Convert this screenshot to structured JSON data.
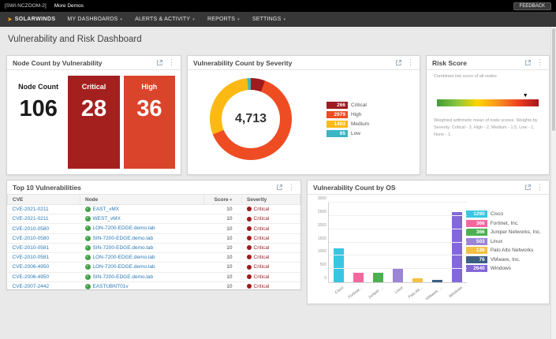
{
  "topbar": {
    "site_label": "[SWI-NCZOOM-2]",
    "more_demos_label": "More Demos",
    "feedback_label": "FEEDBACK"
  },
  "nav": {
    "brand": "SOLARWINDS",
    "items": [
      {
        "label": "MY DASHBOARDS"
      },
      {
        "label": "ALERTS & ACTIVITY"
      },
      {
        "label": "REPORTS"
      },
      {
        "label": "SETTINGS"
      }
    ]
  },
  "page": {
    "title": "Vulnerability and Risk Dashboard"
  },
  "node_count_card": {
    "title": "Node Count by Vulnerability",
    "tiles": [
      {
        "label": "Node Count",
        "value": "106",
        "bg": "#ffffff",
        "fg": "#1a1a1a"
      },
      {
        "label": "Critical",
        "value": "28",
        "bg": "#a4201f",
        "fg": "#ffffff"
      },
      {
        "label": "High",
        "value": "36",
        "bg": "#d9442b",
        "fg": "#ffffff"
      }
    ]
  },
  "severity_card": {
    "title": "Vulnerability Count by Severity"
  },
  "risk_card": {
    "title": "Risk Score",
    "subtitle": "Combined risk score of all nodes",
    "marker_pct": 87,
    "footnote": "Weighted arithmetic mean of node scores. Weights by Severity: Critical - 3, High - 2, Medium - 1.5, Low - 1, None - 1."
  },
  "top10_card": {
    "title": "Top 10 Vulnerabilities",
    "columns": [
      "CVE",
      "Node",
      "Score",
      "Severity"
    ],
    "sort_column": "Score",
    "rows": [
      {
        "cve": "CVE-2021-0211",
        "node": "EAST_vMX",
        "score": "10",
        "severity": "Critical"
      },
      {
        "cve": "CVE-2021-0211",
        "node": "WEST_vMX",
        "score": "10",
        "severity": "Critical"
      },
      {
        "cve": "CVE-2010-0580",
        "node": "LON-7200-EDGE.demo.lab",
        "score": "10",
        "severity": "Critical"
      },
      {
        "cve": "CVE-2010-0580",
        "node": "SIN-7200-EDGE.demo.lab",
        "score": "10",
        "severity": "Critical"
      },
      {
        "cve": "CVE-2010-0581",
        "node": "SIN-7200-EDGE.demo.lab",
        "score": "10",
        "severity": "Critical"
      },
      {
        "cve": "CVE-2010-0581",
        "node": "LON-7200-EDGE.demo.lab",
        "score": "10",
        "severity": "Critical"
      },
      {
        "cve": "CVE-2006-4950",
        "node": "LON-7200-EDGE.demo.lab",
        "score": "10",
        "severity": "Critical"
      },
      {
        "cve": "CVE-2006-4950",
        "node": "SIN-7200-EDGE.demo.lab",
        "score": "10",
        "severity": "Critical"
      },
      {
        "cve": "CVE-2007-2442",
        "node": "EASTUBNT01v",
        "score": "10",
        "severity": "Critical"
      }
    ],
    "severity_color": "#9e1b1f"
  },
  "os_card": {
    "title": "Vulnerability Count by OS"
  },
  "chart_data": [
    {
      "type": "pie",
      "title": "Vulnerability Count by Severity",
      "total": 4713,
      "center_label": "4,713",
      "legend_position": "right",
      "segments": [
        {
          "label": "Critical",
          "value": 266,
          "color": "#9e1b1f"
        },
        {
          "label": "High",
          "value": 2979,
          "color": "#ee4c23"
        },
        {
          "label": "Medium",
          "value": 1403,
          "color": "#fdb913"
        },
        {
          "label": "Low",
          "value": 65,
          "color": "#3eb5c4"
        }
      ]
    },
    {
      "type": "bar",
      "title": "Vulnerability Count by OS",
      "categories": [
        "Cisco",
        "Fortinet, Inc.",
        "Juniper Networks, Inc.",
        "Linux",
        "Palo Alto Networks",
        "VMware, Inc.",
        "Windows"
      ],
      "values": [
        1290,
        366,
        366,
        503,
        136,
        76,
        2640
      ],
      "colors": [
        "#38c6e3",
        "#f4679f",
        "#4cb050",
        "#9b85d6",
        "#f4c142",
        "#3a5f83",
        "#8468d9"
      ],
      "ylim": [
        0,
        3000
      ],
      "ytick_step": 500,
      "legend_position": "right",
      "grid": true
    }
  ]
}
